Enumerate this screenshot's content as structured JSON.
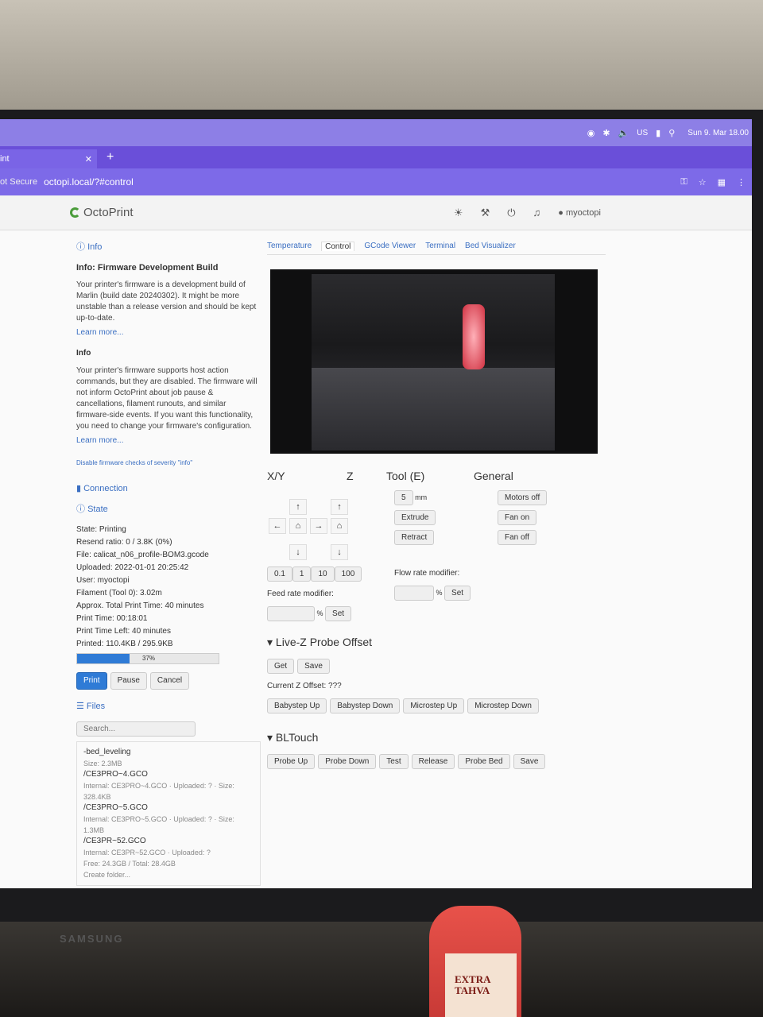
{
  "mac_menubar": {
    "input": "US",
    "clock": "Sun 9. Mar 18.00"
  },
  "browser": {
    "tab_title": "int",
    "security_label": "ot Secure",
    "url": "octopi.local/?#control"
  },
  "navbar": {
    "brand": "OctoPrint",
    "user": "myoctopi"
  },
  "sidebar": {
    "info_header": "Info",
    "info_title": "Info: Firmware Development Build",
    "info_p1": "Your printer's firmware is a development build of Marlin (build date 20240302). It might be more unstable than a release version and should be kept up-to-date.",
    "learn_more_1": "Learn more...",
    "info_sub": "Info",
    "info_p2": "Your printer's firmware supports host action commands, but they are disabled. The firmware will not inform OctoPrint about job pause & cancellations, filament runouts, and similar firmware-side events. If you want this functionality, you need to change your firmware's configuration.",
    "learn_more_2": "Learn more...",
    "disable_link": "Disable firmware checks of severity \"info\"",
    "connection": "Connection",
    "state_header": "State",
    "state": "State: Printing",
    "resend": "Resend ratio: 0 / 3.8K (0%)",
    "file": "File: calicat_n06_profile-BOM3.gcode",
    "uploaded": "Uploaded: 2022-01-01 20:25:42",
    "user": "User: myoctopi",
    "filament": "Filament (Tool 0): 3.02m",
    "approx": "Approx. Total Print Time: 40 minutes",
    "print_time": "Print Time: 00:18:01",
    "time_left": "Print Time Left: 40 minutes",
    "printed": "Printed: 110.4KB / 295.9KB",
    "progress_label": "37%",
    "progress": 0.37,
    "btn_print": "Print",
    "btn_pause": "Pause",
    "btn_cancel": "Cancel",
    "files_header": "Files",
    "search_placeholder": "Search...",
    "files": [
      {
        "name": "-bed_leveling",
        "meta": "Size: 2.3MB"
      },
      {
        "name": "/CE3PRO~4.GCO",
        "meta": "Internal: CE3PRO~4.GCO · Uploaded: ? · Size: 328.4KB"
      },
      {
        "name": "/CE3PRO~5.GCO",
        "meta": "Internal: CE3PRO~5.GCO · Uploaded: ? · Size: 1.3MB"
      },
      {
        "name": "/CE3PR~52.GCO",
        "meta": "Internal: CE3PR~52.GCO · Uploaded: ?"
      }
    ],
    "free": "Free: 24.3GB / Total: 28.4GB",
    "create_folder": "Create folder..."
  },
  "main": {
    "tabs": [
      "Temperature",
      "Control",
      "GCode Viewer",
      "Terminal",
      "Bed Visualizer"
    ],
    "col_xy": "X/Y",
    "col_z": "Z",
    "col_tool": "Tool (E)",
    "col_general": "General",
    "steps": [
      "0.1",
      "1",
      "10",
      "100"
    ],
    "extrude_amount": "5",
    "unit_mm": "mm",
    "extrude": "Extrude",
    "retract": "Retract",
    "motors_off": "Motors off",
    "fan_on": "Fan on",
    "fan_off": "Fan off",
    "feed_label": "Feed rate modifier:",
    "flow_label": "Flow rate modifier:",
    "pct": "%",
    "set": "Set",
    "livez_title": "Live-Z Probe Offset",
    "get": "Get",
    "save": "Save",
    "current_z": "Current Z Offset: ???",
    "babystep": [
      "Babystep Up",
      "Babystep Down",
      "Microstep Up",
      "Microstep Down"
    ],
    "bltouch_title": "BLTouch",
    "bltouch": [
      "Probe Up",
      "Probe Down",
      "Test",
      "Release",
      "Probe Bed",
      "Save"
    ]
  },
  "monitor_brand": "SAMSUNG",
  "can_label": "EXTRA TAHVA"
}
